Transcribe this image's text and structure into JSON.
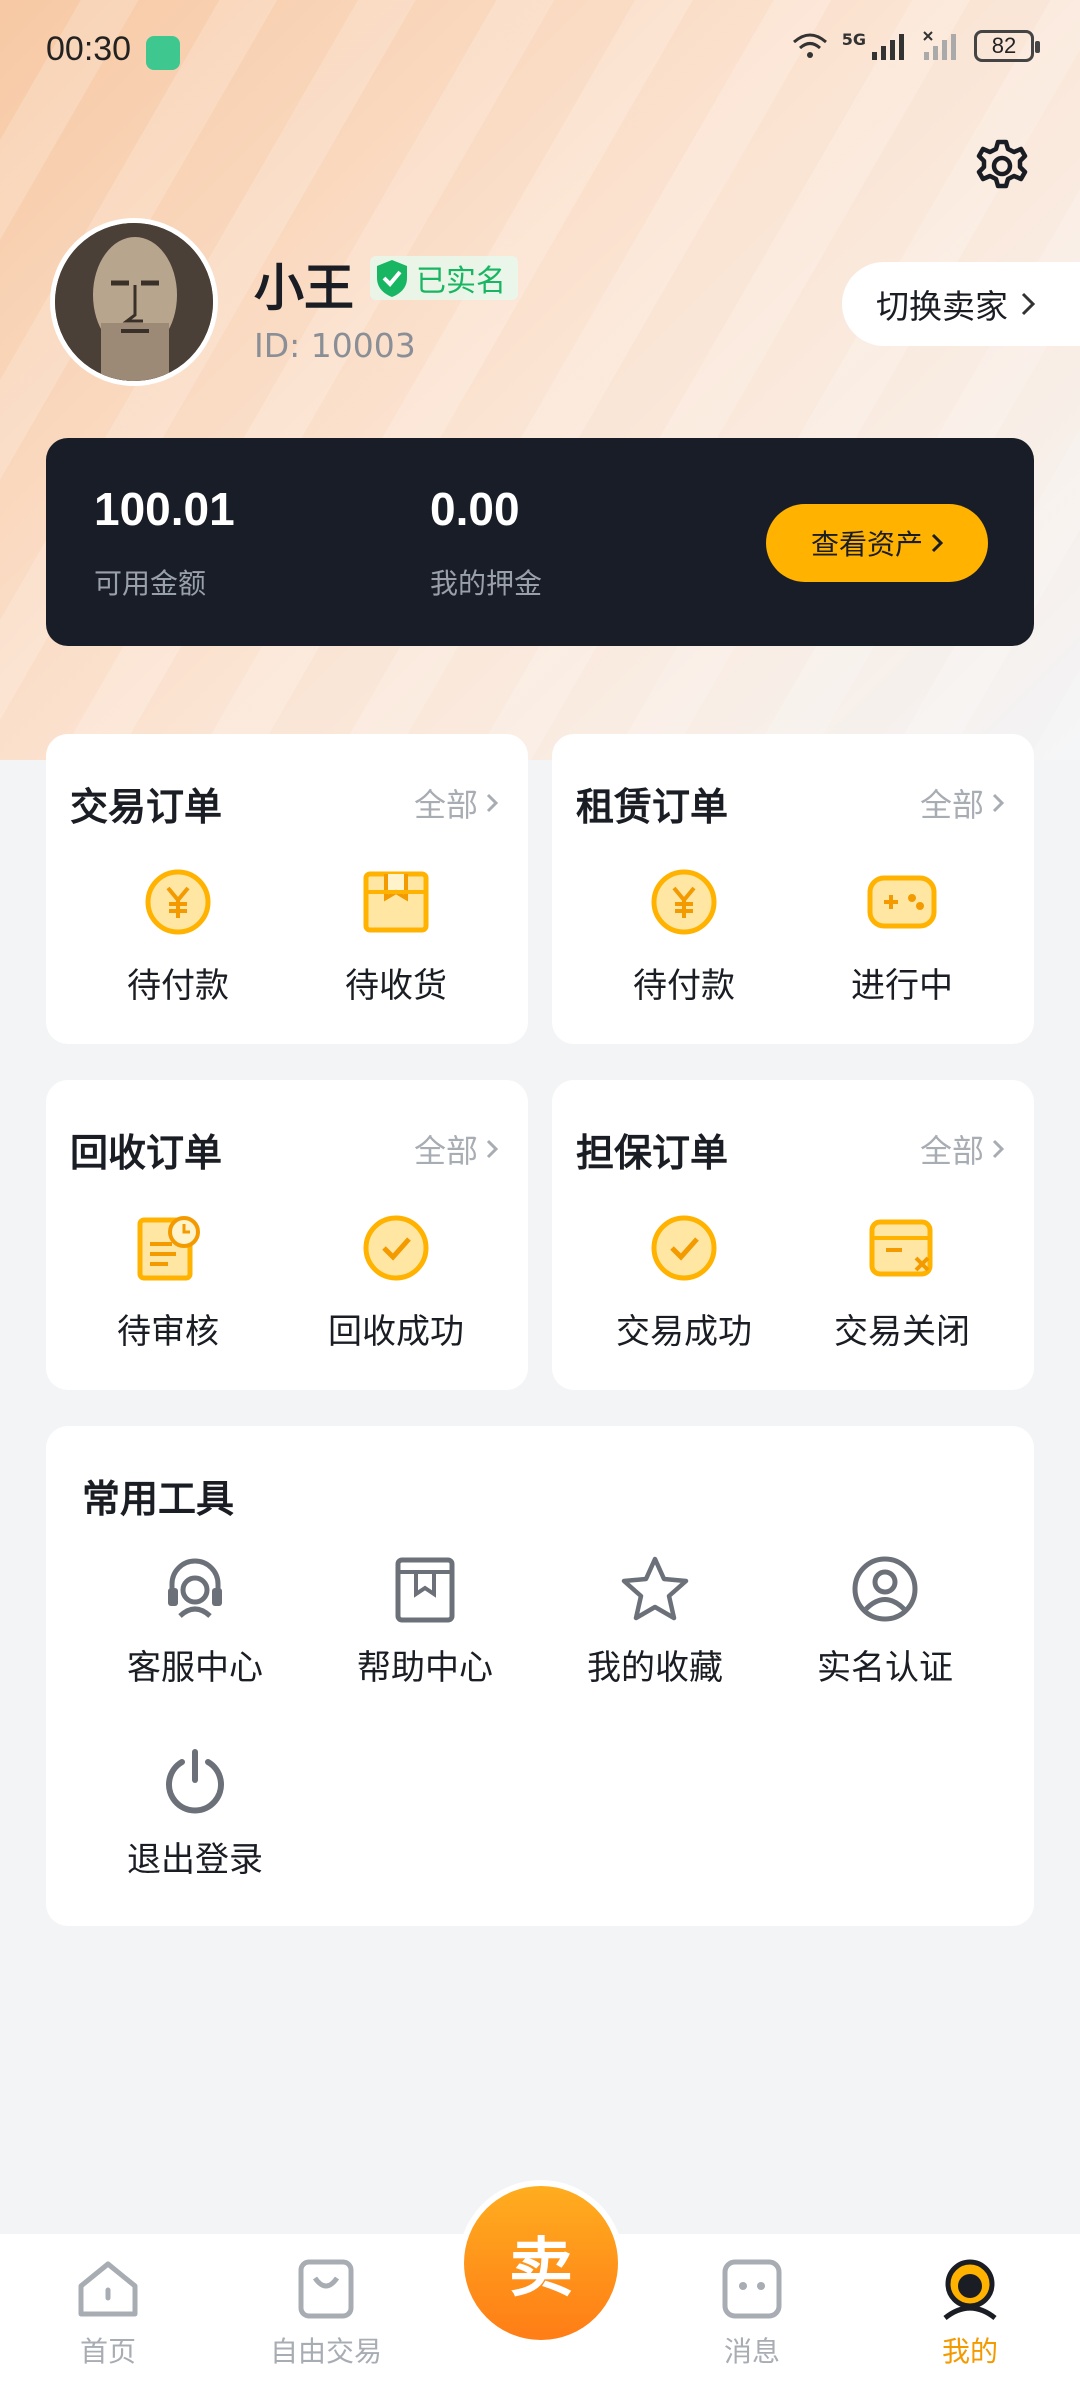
{
  "status_bar": {
    "time": "00:30",
    "network": "5G",
    "battery": "82"
  },
  "profile": {
    "name": "小王",
    "verified_label": "已实名",
    "id": "ID: 10003",
    "switch_label": "切换卖家"
  },
  "assets": {
    "available_amount": "100.01",
    "available_label": "可用金额",
    "deposit_amount": "0.00",
    "deposit_label": "我的押金",
    "view_button": "查看资产"
  },
  "order_cards": [
    {
      "title": "交易订单",
      "all": "全部",
      "items": [
        "待付款",
        "待收货"
      ]
    },
    {
      "title": "租赁订单",
      "all": "全部",
      "items": [
        "待付款",
        "进行中"
      ]
    },
    {
      "title": "回收订单",
      "all": "全部",
      "items": [
        "待审核",
        "回收成功"
      ]
    },
    {
      "title": "担保订单",
      "all": "全部",
      "items": [
        "交易成功",
        "交易关闭"
      ]
    }
  ],
  "tools": {
    "title": "常用工具",
    "items": [
      "客服中心",
      "帮助中心",
      "我的收藏",
      "实名认证",
      "退出登录"
    ]
  },
  "tabbar": {
    "items": [
      "首页",
      "自由交易",
      "消息",
      "我的"
    ],
    "center": "卖",
    "active": "我的"
  },
  "colors": {
    "accent": "#f39a00",
    "verified": "#18b663",
    "dark_card": "#181d27",
    "button_yellow": "#ffb300"
  }
}
